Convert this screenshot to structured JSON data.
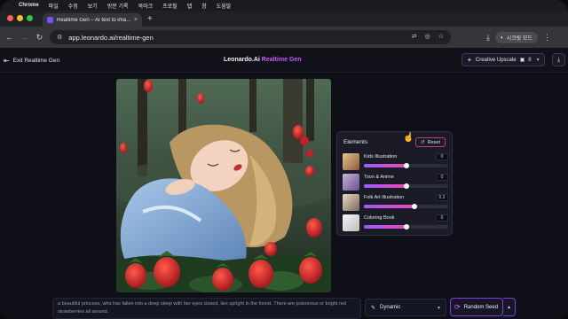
{
  "menubar": {
    "app_name": "Chrome",
    "items": [
      "파일",
      "수정",
      "보기",
      "방문 기록",
      "북마크",
      "프로필",
      "탭",
      "창",
      "도움말"
    ]
  },
  "browser": {
    "tab_title": "Realtime Gen – AI text to ima…",
    "url": "app.leonardo.ai/realtime-gen",
    "secret_label": "시크릿 모드"
  },
  "header": {
    "exit_label": "Exit Realtime Gen",
    "brand": "Leonardo.Ai",
    "brand_accent": "Realtime Gen",
    "upscale_label": "Creative Upscale",
    "upscale_count": "8"
  },
  "elements_panel": {
    "title": "Elements",
    "reset_label": "Reset",
    "items": [
      {
        "label": "Kids Illustration",
        "value": "0",
        "level": 0.5
      },
      {
        "label": "Toon & Anime",
        "value": "0",
        "level": 0.5
      },
      {
        "label": "Folk Art Illustration",
        "value": "0.3",
        "level": 0.6
      },
      {
        "label": "Coloring Book",
        "value": "0",
        "level": 0.5
      }
    ]
  },
  "prompt": {
    "text": "a beautiful princess, who has fallen into a deep sleep with her eyes closed, lies upright in the forest. There are poisonous or bright red strawberries all around."
  },
  "style_select": {
    "value": "Dynamic"
  },
  "seed_button": {
    "label": "Random Seed"
  },
  "colors": {
    "accent": "#c35dfa",
    "button_border": "#7d3fe0",
    "reset_border": "#c13a8a"
  }
}
